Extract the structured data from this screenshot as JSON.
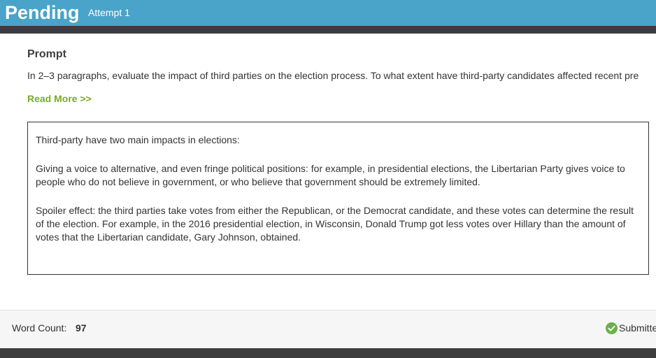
{
  "header": {
    "title": "Pending",
    "attempt": "Attempt 1"
  },
  "prompt": {
    "heading": "Prompt",
    "text": "In 2–3 paragraphs, evaluate the impact of third parties on the election process. To what extent have third-party candidates affected recent pre",
    "read_more": "Read More >>"
  },
  "answer": {
    "paragraphs": [
      "Third-party have two main impacts in elections:",
      "Giving a voice to alternative, and even fringe political positions: for example, in presidential elections, the Libertarian Party gives voice to people who do not believe in government, or who believe that government should be extremely limited.",
      "Spoiler effect: the third parties take votes from either the Republican, or the Democrat candidate, and these votes can determine the result of the election. For example, in the 2016 presidential election, in Wisconsin, Donald Trump got less votes over Hillary than the amount of votes that the Libertarian candidate, Gary Johnson, obtained."
    ]
  },
  "footer": {
    "word_count_label": "Word Count:",
    "word_count_value": "97",
    "status": "Submitted",
    "status_icon": "check-circle-icon"
  },
  "colors": {
    "header_bg": "#4aa3c8",
    "dark_bar": "#3d3d3d",
    "accent_green": "#78ad1f",
    "check_green": "#6ab04c"
  }
}
